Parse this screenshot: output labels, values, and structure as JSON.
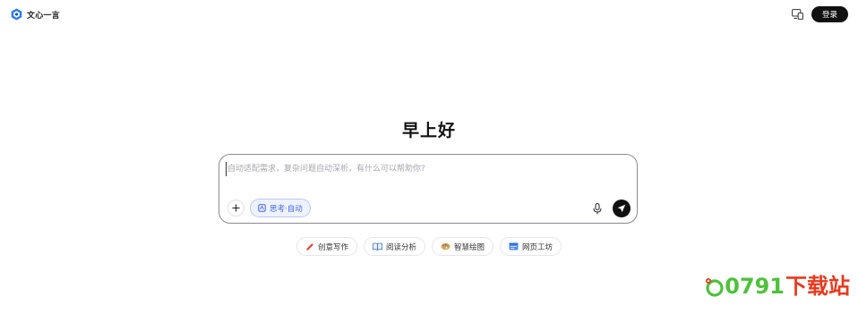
{
  "header": {
    "app_name": "文心一言",
    "login_label": "登录"
  },
  "main": {
    "greeting": "早上好",
    "input_placeholder": "自动适配需求，复杂问题自动深析，有什么可以帮助你?",
    "think_mode_label": "思考·自动"
  },
  "quick_actions": [
    {
      "label": "创意写作",
      "icon": "pencil-icon"
    },
    {
      "label": "阅读分析",
      "icon": "book-icon"
    },
    {
      "label": "智慧绘图",
      "icon": "palette-icon"
    },
    {
      "label": "网页工坊",
      "icon": "webpage-icon"
    }
  ],
  "watermark": {
    "number_text": "0791",
    "cn_text": "下载站"
  },
  "colors": {
    "accent_blue": "#4465e6",
    "send_button": "#111111",
    "watermark_green": "#4fc13c",
    "watermark_red": "#e8391d"
  }
}
